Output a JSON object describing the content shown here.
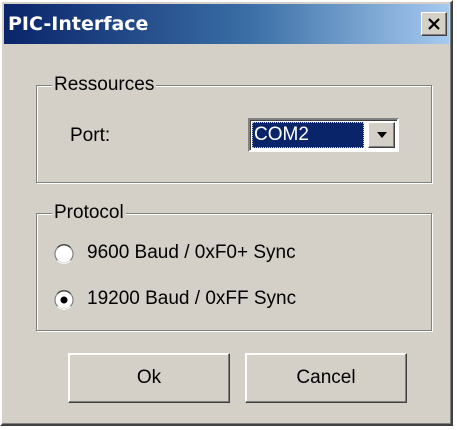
{
  "window": {
    "title": "PIC-Interface",
    "colors": {
      "face": "#d4d0c8",
      "titlebar_start": "#0a246a",
      "titlebar_end": "#a6caf0",
      "selection": "#0a246a"
    }
  },
  "titlebar": {
    "close_icon": "close-icon"
  },
  "resources_group": {
    "legend": "Ressources",
    "port_label": "Port:",
    "port_value": "COM2",
    "dropdown_icon": "chevron-down-icon"
  },
  "protocol_group": {
    "legend": "Protocol",
    "options": [
      {
        "label": "9600 Baud / 0xF0+ Sync",
        "selected": false
      },
      {
        "label": "19200 Baud / 0xFF Sync",
        "selected": true
      }
    ]
  },
  "buttons": {
    "ok_label": "Ok",
    "cancel_label": "Cancel"
  }
}
